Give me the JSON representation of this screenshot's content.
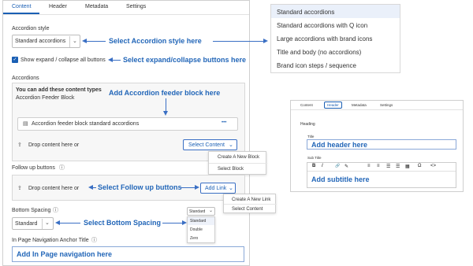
{
  "tabs": [
    "Content",
    "Header",
    "Metadata",
    "Settings"
  ],
  "accordion_style": {
    "label": "Accordion style",
    "value": "Standard accordions",
    "annotation": "Select Accordion style here"
  },
  "expand_collapse": {
    "label": "Show expand / collapse all buttons",
    "checked": true,
    "annotation": "Select expand/collapse buttons here"
  },
  "accordions": {
    "label": "Accordions",
    "info_title": "You can add these content types",
    "info_type": "Accordion Feeder Block",
    "annotation": "Add Accordion feeder block here",
    "block_label": "Accordion feeder block standard accordions",
    "more_label": "•••",
    "drop_text": "Drop content here or",
    "select_button": "Select Content",
    "menu": [
      "Create A New Block",
      "Select Block"
    ]
  },
  "follow_up": {
    "label": "Follow up buttons",
    "drop_text": "Drop content here or",
    "annotation": "Select Follow up buttons",
    "button": "Add Link",
    "menu": [
      "Create A New Link",
      "Select Content"
    ]
  },
  "bottom_spacing": {
    "label": "Bottom Spacing",
    "value": "Standard",
    "annotation": "Select Bottom  Spacing",
    "mini_value": "Standard",
    "options": [
      "Standard",
      "Double",
      "Zero"
    ]
  },
  "anchor": {
    "label": "In Page Navigation Anchor Title",
    "annotation": "Add  In Page navigation here"
  },
  "style_options": [
    "Standard accordions",
    "Standard accordions with Q icon",
    "Large accordions with brand icons",
    "Title and body (no accordions)",
    "Brand icon steps / sequence"
  ],
  "header_panel": {
    "tabs": [
      "Content",
      "Header",
      "Metadata",
      "Settings"
    ],
    "heading_label": "Heading",
    "title_label": "Title",
    "title_annotation": "Add header here",
    "subtitle_label": "Sub Title",
    "subtitle_annotation": "Add subtitle here",
    "toolbar": [
      "B",
      "I",
      "🔗",
      "✎",
      "≡",
      "≡",
      "☰",
      "☰",
      "▦",
      "Ω",
      "<>"
    ]
  },
  "colors": {
    "accent": "#1a5fb4",
    "annotation": "#2266b8"
  }
}
